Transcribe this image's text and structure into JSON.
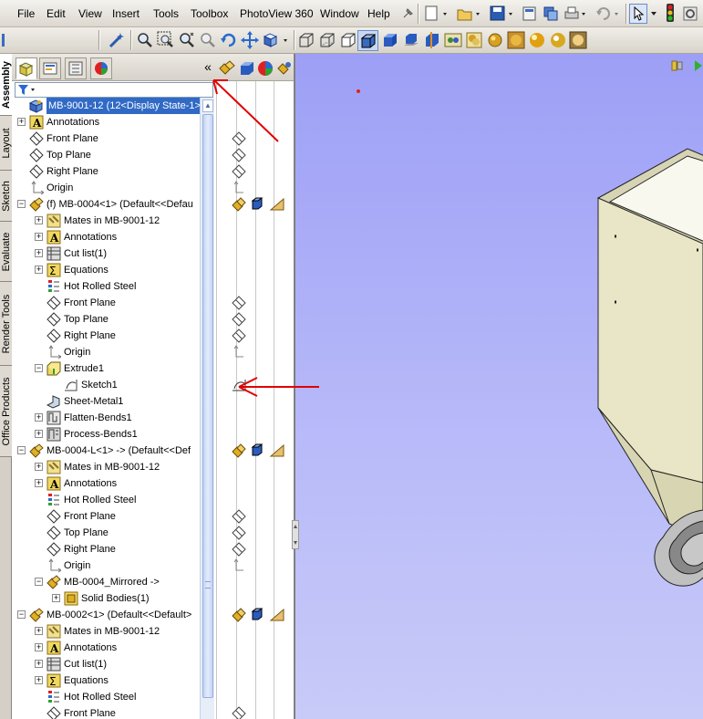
{
  "menu": [
    "File",
    "Edit",
    "View",
    "Insert",
    "Tools",
    "Toolbox",
    "PhotoView 360",
    "Window",
    "Help"
  ],
  "vertical_tabs": [
    "Assembly",
    "Layout",
    "Sketch",
    "Evaluate",
    "Render Tools",
    "Office Products"
  ],
  "feature_tree": {
    "collapse_glyph": "«",
    "rows": [
      {
        "label": "MB-9001-12  (12<Display State-1>)",
        "indent": 0,
        "icon": "assembly-icon",
        "expander": "",
        "selected": true
      },
      {
        "label": "Annotations",
        "indent": 0,
        "icon": "annotations-icon",
        "expander": "+"
      },
      {
        "label": "Front Plane",
        "indent": 0,
        "icon": "plane-icon",
        "expander": ""
      },
      {
        "label": "Top Plane",
        "indent": 0,
        "icon": "plane-icon",
        "expander": ""
      },
      {
        "label": "Right Plane",
        "indent": 0,
        "icon": "plane-icon",
        "expander": ""
      },
      {
        "label": "Origin",
        "indent": 0,
        "icon": "origin-icon",
        "expander": ""
      },
      {
        "label": "(f) MB-0004<1> (Default<<Defau",
        "indent": 0,
        "icon": "part-icon",
        "expander": "−"
      },
      {
        "label": "Mates in MB-9001-12",
        "indent": 1,
        "icon": "mates-icon",
        "expander": "+"
      },
      {
        "label": "Annotations",
        "indent": 1,
        "icon": "annotations-icon",
        "expander": "+"
      },
      {
        "label": "Cut list(1)",
        "indent": 1,
        "icon": "cutlist-icon",
        "expander": "+"
      },
      {
        "label": "Equations",
        "indent": 1,
        "icon": "equations-icon",
        "expander": "+"
      },
      {
        "label": "Hot Rolled Steel",
        "indent": 1,
        "icon": "material-icon",
        "expander": ""
      },
      {
        "label": "Front Plane",
        "indent": 1,
        "icon": "plane-icon",
        "expander": ""
      },
      {
        "label": "Top Plane",
        "indent": 1,
        "icon": "plane-icon",
        "expander": ""
      },
      {
        "label": "Right Plane",
        "indent": 1,
        "icon": "plane-icon",
        "expander": ""
      },
      {
        "label": "Origin",
        "indent": 1,
        "icon": "origin-icon",
        "expander": ""
      },
      {
        "label": "Extrude1",
        "indent": 1,
        "icon": "extrude-icon",
        "expander": "−"
      },
      {
        "label": "Sketch1",
        "indent": 2,
        "icon": "sketch-icon",
        "expander": ""
      },
      {
        "label": "Sheet-Metal1",
        "indent": 1,
        "icon": "sheetmetal-icon",
        "expander": ""
      },
      {
        "label": "Flatten-Bends1",
        "indent": 1,
        "icon": "flatten-icon",
        "expander": "+"
      },
      {
        "label": "Process-Bends1",
        "indent": 1,
        "icon": "process-bends-icon",
        "expander": "+"
      },
      {
        "label": "MB-0004-L<1> -> (Default<<Def",
        "indent": 0,
        "icon": "part-icon",
        "expander": "−"
      },
      {
        "label": "Mates in MB-9001-12",
        "indent": 1,
        "icon": "mates-icon",
        "expander": "+"
      },
      {
        "label": "Annotations",
        "indent": 1,
        "icon": "annotations-icon",
        "expander": "+"
      },
      {
        "label": "Hot Rolled Steel",
        "indent": 1,
        "icon": "material-icon",
        "expander": ""
      },
      {
        "label": "Front Plane",
        "indent": 1,
        "icon": "plane-icon",
        "expander": ""
      },
      {
        "label": "Top Plane",
        "indent": 1,
        "icon": "plane-icon",
        "expander": ""
      },
      {
        "label": "Right Plane",
        "indent": 1,
        "icon": "plane-icon",
        "expander": ""
      },
      {
        "label": "Origin",
        "indent": 1,
        "icon": "origin-icon",
        "expander": ""
      },
      {
        "label": "MB-0004_Mirrored ->",
        "indent": 1,
        "icon": "part-icon",
        "expander": "−"
      },
      {
        "label": "Solid Bodies(1)",
        "indent": 2,
        "icon": "solid-bodies-icon",
        "expander": "+"
      },
      {
        "label": "MB-0002<1> (Default<<Default>",
        "indent": 0,
        "icon": "part-icon",
        "expander": "−"
      },
      {
        "label": "Mates in MB-9001-12",
        "indent": 1,
        "icon": "mates-icon",
        "expander": "+"
      },
      {
        "label": "Annotations",
        "indent": 1,
        "icon": "annotations-icon",
        "expander": "+"
      },
      {
        "label": "Cut list(1)",
        "indent": 1,
        "icon": "cutlist-icon",
        "expander": "+"
      },
      {
        "label": "Equations",
        "indent": 1,
        "icon": "equations-icon",
        "expander": "+"
      },
      {
        "label": "Hot Rolled Steel",
        "indent": 1,
        "icon": "material-icon",
        "expander": ""
      },
      {
        "label": "Front Plane",
        "indent": 1,
        "icon": "plane-icon",
        "expander": ""
      }
    ]
  },
  "colors": {
    "selection": "#316ac5",
    "viewport_top": "#9d9ff6",
    "viewport_bottom": "#c8caf8",
    "annotation_arrow": "#e00000",
    "part_face": "#e6e4c4"
  }
}
